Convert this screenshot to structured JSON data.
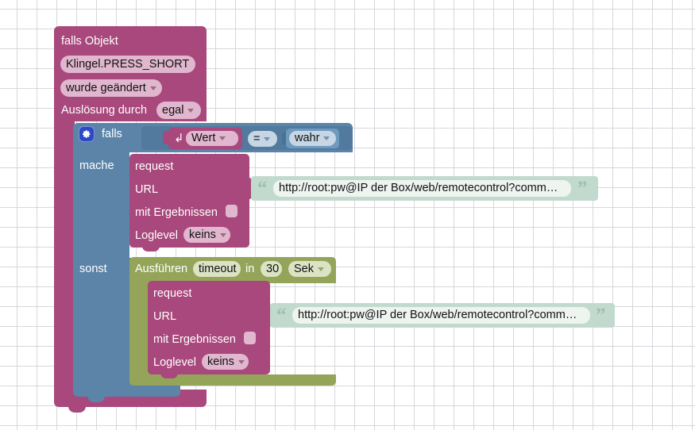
{
  "app": {
    "kind": "blockly-visual-program",
    "language": "de"
  },
  "colors": {
    "event_block": "#a8487c",
    "control_block": "#5b84a8",
    "timer_block": "#94a55a",
    "string_block": "#c2dace",
    "field_magenta": "#e0b7ce",
    "field_blue": "#c6d6e4",
    "field_olive": "#dbe3c4",
    "gear_icon": "#2b49c8",
    "grid_dot": "#d6d6dc",
    "canvas": "#ffffff"
  },
  "event_block": {
    "title": "falls Objekt",
    "object_field": "Klingel.PRESS_SHORT",
    "condition_field": "wurde geändert",
    "trigger_label": "Auslösung durch",
    "trigger_field": "egal"
  },
  "if_block": {
    "gear_icon": "gear-icon",
    "if_label": "falls",
    "do_label": "mache",
    "else_label": "sonst",
    "condition": {
      "value_icon": "return-arrow-icon",
      "value_field": "Wert",
      "operator_field": "=",
      "compare_field": "wahr"
    }
  },
  "request_do": {
    "title": "request",
    "url_label": "URL",
    "results_label": "mit Ergebnissen",
    "results_checked": false,
    "loglevel_label": "Loglevel",
    "loglevel_field": "keins",
    "url_value": "http://root:pw@IP der Box/web/remotecontrol?comm…",
    "quote_open": "“",
    "quote_close": "”"
  },
  "timer_block": {
    "run_label": "Ausführen",
    "name_field": "timeout",
    "in_label": "in",
    "delay_field": "30",
    "unit_field": "Sek"
  },
  "request_else": {
    "title": "request",
    "url_label": "URL",
    "results_label": "mit Ergebnissen",
    "results_checked": false,
    "loglevel_label": "Loglevel",
    "loglevel_field": "keins",
    "url_value": "http://root:pw@IP der Box/web/remotecontrol?comm…",
    "quote_open": "“",
    "quote_close": "”"
  }
}
